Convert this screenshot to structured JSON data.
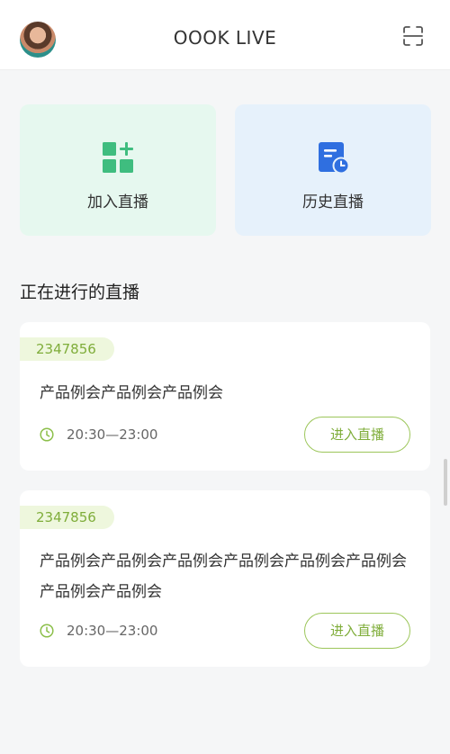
{
  "header": {
    "title": "OOOK LIVE"
  },
  "actions": {
    "join_label": "加入直播",
    "history_label": "历史直播"
  },
  "section": {
    "title": "正在进行的直播"
  },
  "live_list": [
    {
      "id": "2347856",
      "title": "产品例会产品例会产品例会",
      "time": "20:30—23:00",
      "button_label": "进入直播"
    },
    {
      "id": "2347856",
      "title": "产品例会产品例会产品例会产品例会产品例会产品例会产品例会产品例会",
      "time": "20:30—23:00",
      "button_label": "进入直播"
    }
  ],
  "colors": {
    "accent_green": "#7fad3a",
    "join_tile_bg": "#e6f8ef",
    "history_tile_bg": "#e6f1fb",
    "join_icon": "#3fbd7f",
    "history_icon": "#2f6fe0"
  },
  "icons": {
    "scan": "scan-icon",
    "join": "grid-plus-icon",
    "history": "document-clock-icon",
    "clock": "clock-icon"
  }
}
